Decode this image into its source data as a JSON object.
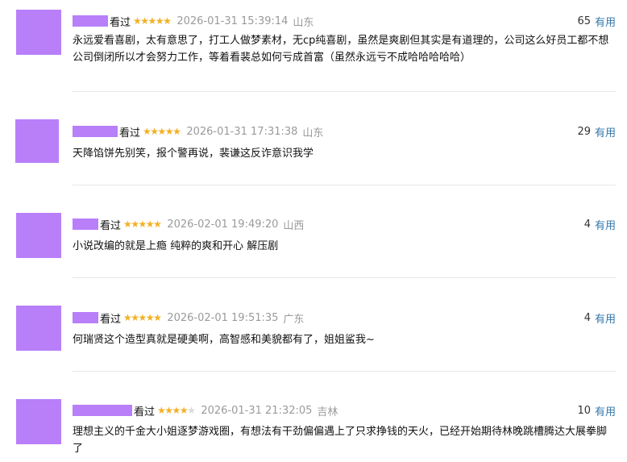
{
  "comments": [
    {
      "watched_label": "看过",
      "rating": 5,
      "time": "2026-01-31 15:39:14",
      "location": "山东",
      "vote_count": "65",
      "useful_label": "有用",
      "text": "永远爱看喜剧，太有意思了，打工人做梦素材，无cp纯喜剧，虽然是爽剧但其实是有道理的，公司这么好员工都不想公司倒闭所以才会努力工作，等着看裴总如何亏成首富（虽然永远亏不成哈哈哈哈哈）"
    },
    {
      "watched_label": "看过",
      "rating": 5,
      "time": "2026-01-31 17:31:38",
      "location": "山东",
      "vote_count": "29",
      "useful_label": "有用",
      "text": "天降馅饼先别笑，报个警再说，裴谦这反诈意识我学"
    },
    {
      "watched_label": "看过",
      "rating": 5,
      "time": "2026-02-01 19:49:20",
      "location": "山西",
      "vote_count": "4",
      "useful_label": "有用",
      "text": "小说改编的就是上瘾 纯粹的爽和开心 解压剧"
    },
    {
      "watched_label": "看过",
      "rating": 5,
      "time": "2026-02-01 19:51:35",
      "location": "广东",
      "vote_count": "4",
      "useful_label": "有用",
      "text": "何瑞贤这个造型真就是硬美啊，高智感和美貌都有了，姐姐鲨我~"
    },
    {
      "watched_label": "看过",
      "rating": 4,
      "time": "2026-01-31 21:32:05",
      "location": "吉林",
      "vote_count": "10",
      "useful_label": "有用",
      "text": "理想主义的千金大小姐逐梦游戏圈，有想法有干劲偏偏遇上了只求挣钱的天火，已经开始期待林晚跳槽腾达大展拳脚了"
    }
  ],
  "colors": {
    "avatar": "#b87ff9",
    "star": "#f3b024",
    "useful_link": "#3377aa",
    "meta_gray": "#9a9a9a"
  }
}
